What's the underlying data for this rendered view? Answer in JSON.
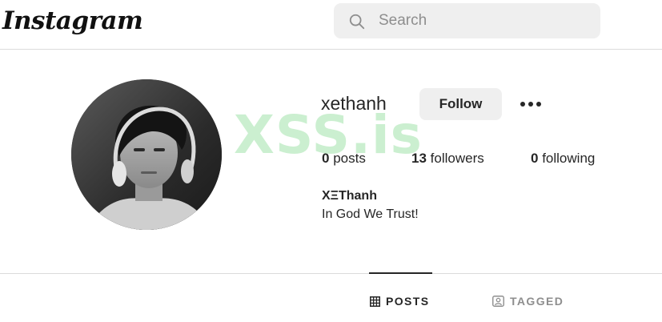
{
  "header": {
    "logo_text": "Instagram",
    "search_placeholder": "Search",
    "search_icon": "search-icon"
  },
  "profile": {
    "username": "xethanh",
    "follow_label": "Follow",
    "more_icon": "more-options-icon",
    "stats": {
      "posts_count": "0",
      "posts_label": "posts",
      "followers_count": "13",
      "followers_label": "followers",
      "following_count": "0",
      "following_label": "following"
    },
    "full_name": "XΞThanh",
    "bio": "In God We Trust!"
  },
  "watermark": "XSS.is",
  "tabs": [
    {
      "label": "POSTS",
      "icon": "grid-icon",
      "active": true
    },
    {
      "label": "TAGGED",
      "icon": "tagged-icon",
      "active": false
    }
  ],
  "colors": {
    "text": "#262626",
    "muted": "#8e8e8e",
    "button_bg": "#efefef",
    "divider": "#dbdbdb",
    "watermark": "#8cdc96"
  }
}
